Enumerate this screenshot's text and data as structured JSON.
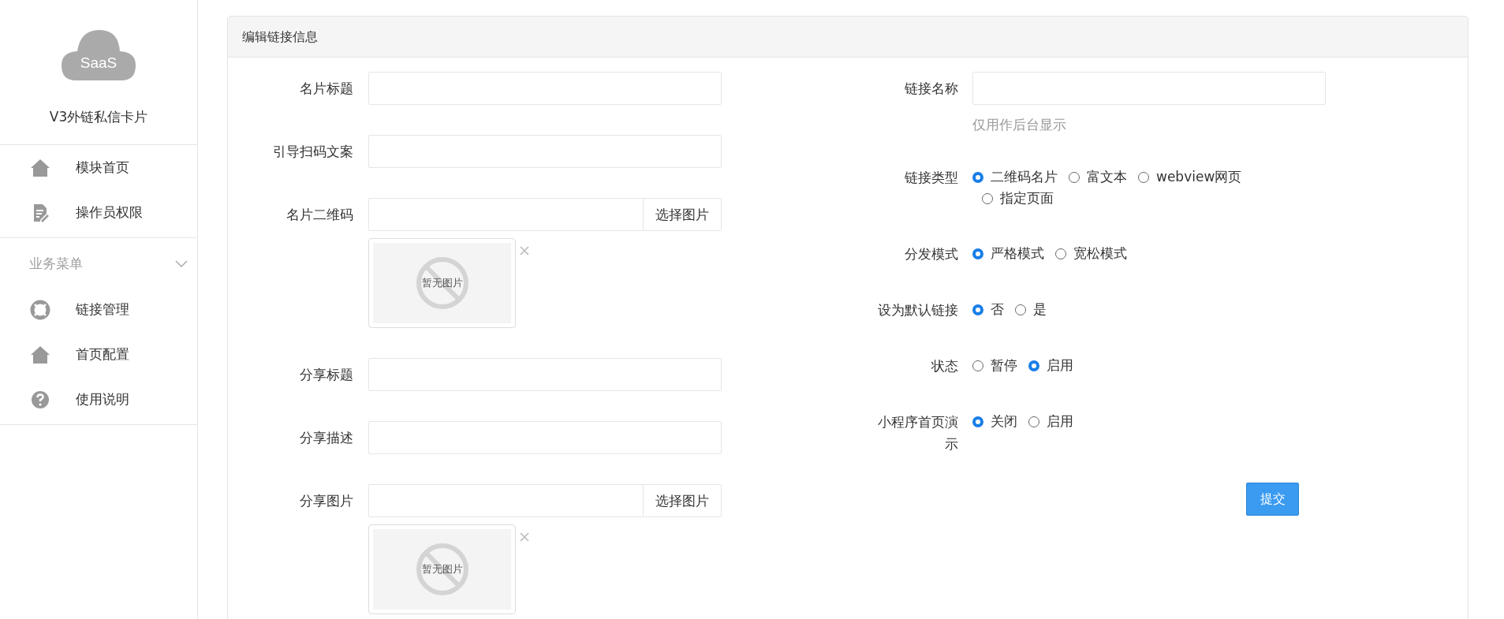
{
  "sidebar": {
    "logo_text": "SaaS",
    "app_title": "V3外链私信卡片",
    "menu": [
      {
        "label": "模块首页",
        "kind": "home"
      },
      {
        "label": "操作员权限",
        "kind": "document"
      }
    ],
    "groups": [
      {
        "title": "业务菜单",
        "expanded": true,
        "items": [
          {
            "label": "链接管理",
            "kind": "lifebuoy"
          },
          {
            "label": "首页配置",
            "kind": "home"
          },
          {
            "label": "使用说明",
            "kind": "help"
          }
        ]
      }
    ]
  },
  "panel": {
    "title": "编辑链接信息",
    "left_fields": [
      {
        "kind": "text",
        "label": "名片标题"
      },
      {
        "kind": "text",
        "label": "引导扫码文案"
      },
      {
        "kind": "image",
        "label": "名片二维码",
        "button": "选择图片",
        "preview_text": "暂无图片"
      },
      {
        "kind": "text",
        "label": "分享标题"
      },
      {
        "kind": "text",
        "label": "分享描述"
      },
      {
        "kind": "image",
        "label": "分享图片",
        "button": "选择图片",
        "preview_text": "暂无图片"
      }
    ],
    "right_fields": [
      {
        "kind": "text",
        "label": "链接名称",
        "hint": "仅用作后台显示"
      },
      {
        "kind": "radio",
        "label": "链接类型",
        "options": [
          {
            "label": "二维码名片",
            "selected": true
          },
          {
            "label": "富文本",
            "selected": false
          },
          {
            "label": "webview网页",
            "selected": false
          },
          {
            "label": "指定页面",
            "selected": false
          }
        ]
      },
      {
        "kind": "radio",
        "label": "分发模式",
        "options": [
          {
            "label": "严格模式",
            "selected": true
          },
          {
            "label": "宽松模式",
            "selected": false
          }
        ]
      },
      {
        "kind": "radio",
        "label": "设为默认链接",
        "options": [
          {
            "label": "否",
            "selected": true
          },
          {
            "label": "是",
            "selected": false
          }
        ]
      },
      {
        "kind": "radio",
        "label": "状态",
        "options": [
          {
            "label": "暂停",
            "selected": false
          },
          {
            "label": "启用",
            "selected": true
          }
        ]
      },
      {
        "kind": "radio",
        "label": "小程序首页演示",
        "options": [
          {
            "label": "关闭",
            "selected": true
          },
          {
            "label": "启用",
            "selected": false
          }
        ]
      }
    ],
    "submit": "提交"
  }
}
